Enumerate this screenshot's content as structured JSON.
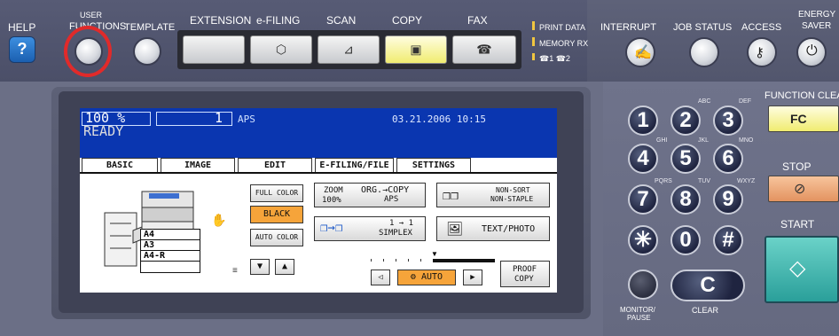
{
  "top_panel": {
    "help_label": "HELP",
    "help_icon": "?",
    "user_functions_label_1": "USER",
    "user_functions_label_2": "FUNCTIONS",
    "template_label": "TEMPLATE",
    "extension_label": "EXTENSION",
    "efiling_label": "e-FILING",
    "scan_label": "SCAN",
    "copy_label": "COPY",
    "fax_label": "FAX",
    "print_data_label": "PRINT DATA",
    "memory_rx_label": "MEMORY RX",
    "line_status_label": "☎1 ☎2",
    "interrupt_label": "INTERRUPT",
    "job_status_label": "JOB STATUS",
    "access_label": "ACCESS",
    "energy_saver_label_1": "ENERGY",
    "energy_saver_label_2": "SAVER",
    "function_clear_label": "FUNCTION CLEA",
    "fc_label": "FC",
    "stop_label": "STOP",
    "start_label": "START",
    "monitor_pause_label_1": "MONITOR/",
    "monitor_pause_label_2": "PAUSE",
    "clear_label": "CLEAR",
    "clear_key": "C"
  },
  "lcd": {
    "zoom": "100 %",
    "copies": "1",
    "mode": "APS",
    "status": "READY",
    "datetime": "03.21.2006 10:15",
    "tabs": [
      "BASIC",
      "IMAGE",
      "EDIT",
      "E-FILING/FILE",
      "SETTINGS"
    ],
    "full_color": "FULL COLOR",
    "black": "BLACK",
    "auto_color": "AUTO COLOR",
    "zoom_btn_line1": "ZOOM",
    "zoom_btn_line2": "100%",
    "org_copy_line1": "ORG.→COPY",
    "org_copy_line2": "APS",
    "duplex_line1": "1 → 1",
    "duplex_line2": "SIMPLEX",
    "finisher_line1": "NON-SORT",
    "finisher_line2": "NON-STAPLE",
    "text_photo": "TEXT/PHOTO",
    "auto_density": "AUTO",
    "proof_copy_line1": "PROOF",
    "proof_copy_line2": "COPY",
    "paper_sizes": [
      "A4",
      "A3",
      "A4-R",
      ""
    ]
  },
  "keypad": {
    "keys": [
      "1",
      "2",
      "3",
      "4",
      "5",
      "6",
      "7",
      "8",
      "9",
      "✳",
      "0",
      "#"
    ],
    "subs": [
      "",
      "ABC",
      "DEF",
      "GHI",
      "JKL",
      "MNO",
      "PQRS",
      "TUV",
      "WXYZ",
      "",
      "",
      ""
    ]
  },
  "colors": {
    "lcd_header": "#0a36b0",
    "highlight_orange": "#f6a43a",
    "panel_dark": "#4b4f68",
    "annotation_red": "#e12a2a"
  }
}
